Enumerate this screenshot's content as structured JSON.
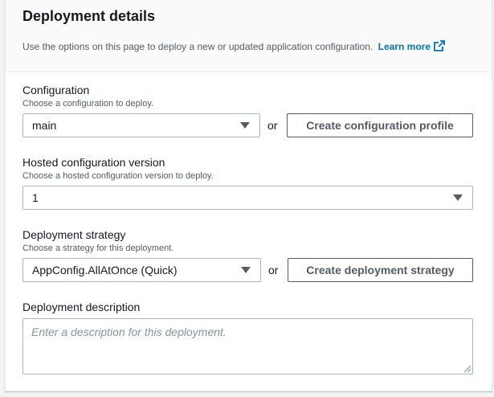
{
  "header": {
    "title": "Deployment details",
    "description": "Use the options on this page to deploy a new or updated application configuration.",
    "learn_more": "Learn more"
  },
  "configuration": {
    "label": "Configuration",
    "hint": "Choose a configuration to deploy.",
    "selected": "main",
    "or": "or",
    "create_button": "Create configuration profile"
  },
  "version": {
    "label": "Hosted configuration version",
    "hint": "Choose a hosted configuration version to deploy.",
    "selected": "1"
  },
  "strategy": {
    "label": "Deployment strategy",
    "hint": "Choose a strategy for this deployment.",
    "selected": "AppConfig.AllAtOnce (Quick)",
    "or": "or",
    "create_button": "Create deployment strategy"
  },
  "description": {
    "label": "Deployment description",
    "placeholder": "Enter a description for this deployment."
  },
  "colors": {
    "link": "#0073bb",
    "border": "#aab7b8",
    "muted_text": "#545b64"
  }
}
